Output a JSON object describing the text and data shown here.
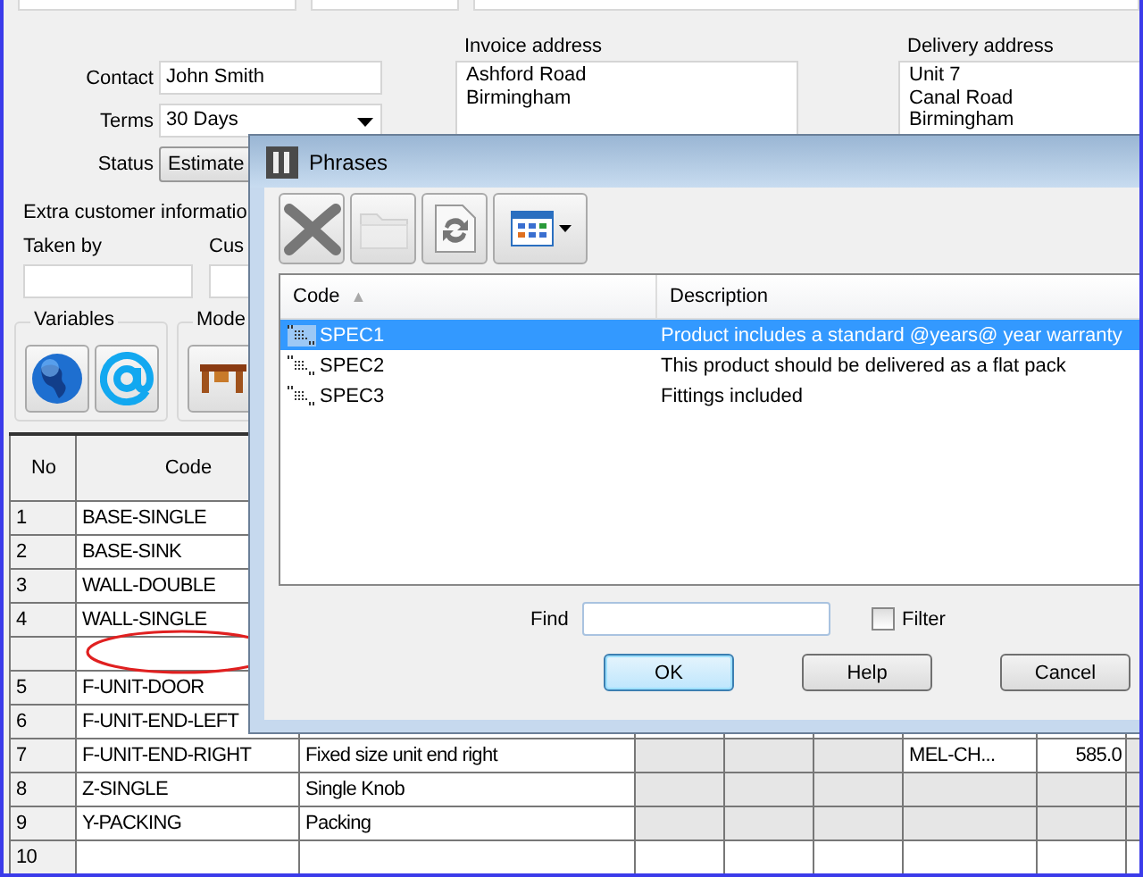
{
  "customer": {
    "fields": [
      {
        "kind": "text",
        "label": "Contact",
        "value": "John Smith"
      },
      {
        "kind": "dropdown",
        "label": "Terms",
        "value": "30 Days"
      },
      {
        "kind": "button",
        "label": "Status",
        "value": "Estimate"
      }
    ]
  },
  "invoice_address": {
    "label": "Invoice address",
    "lines": [
      "Ashford Road",
      "Birmingham"
    ]
  },
  "delivery_address": {
    "label": "Delivery address",
    "lines": [
      "Unit 7",
      "Canal Road",
      "Birmingham"
    ]
  },
  "extra_info": {
    "heading": "Extra customer informatio",
    "fields": [
      {
        "label": "Taken by"
      },
      {
        "label": "Cus"
      }
    ]
  },
  "groups": [
    {
      "label": "Variables",
      "buttons": [
        {
          "kind": "globe"
        },
        {
          "kind": "at"
        }
      ]
    },
    {
      "label": "Mode",
      "buttons": [
        {
          "kind": "desk"
        }
      ]
    }
  ],
  "grid": {
    "columns": [
      {
        "label": "No"
      },
      {
        "label": "Code"
      }
    ],
    "rows": [
      {
        "kind": "item",
        "no": "1",
        "code": "BASE-SINGLE"
      },
      {
        "kind": "item",
        "no": "2",
        "code": "BASE-SINK"
      },
      {
        "kind": "item",
        "no": "3",
        "code": "WALL-DOUBLE"
      },
      {
        "kind": "item",
        "no": "4",
        "code": "WALL-SINGLE"
      },
      {
        "kind": "blank"
      },
      {
        "kind": "item",
        "no": "5",
        "code": "F-UNIT-DOOR"
      },
      {
        "kind": "item",
        "no": "6",
        "code": "F-UNIT-END-LEFT"
      },
      {
        "kind": "item",
        "no": "7",
        "code": "F-UNIT-END-RIGHT",
        "description": "Fixed size unit end right",
        "column_7": "MEL-CH...",
        "column_8": "585.0",
        "shaded": true
      },
      {
        "kind": "item",
        "no": "8",
        "code": "Z-SINGLE",
        "description": "Single Knob",
        "shaded": true
      },
      {
        "kind": "item",
        "no": "9",
        "code": "Y-PACKING",
        "description": "Packing",
        "shaded": true
      },
      {
        "kind": "item",
        "no": "10",
        "shaded": false
      }
    ]
  },
  "annotation": {
    "kind": "ellipse"
  },
  "dialog": {
    "title": "Phrases",
    "tools": [
      {
        "kind": "delete",
        "disabled": false
      },
      {
        "kind": "folder",
        "disabled": true
      },
      {
        "kind": "refresh",
        "disabled": false
      },
      {
        "kind": "view",
        "disabled": false
      }
    ],
    "list": {
      "columns": [
        {
          "label": "Code",
          "sort_indicator": "▲"
        },
        {
          "label": "Description"
        }
      ],
      "rows": [
        {
          "code": "SPEC1",
          "description": "Product includes a standard @years@ year warranty",
          "selected": true
        },
        {
          "code": "SPEC2",
          "description": "This product should be delivered as a flat pack",
          "selected": false
        },
        {
          "code": "SPEC3",
          "description": "Fittings included",
          "selected": false
        }
      ]
    },
    "find": {
      "label": "Find"
    },
    "filter": {
      "label": "Filter",
      "checked": false
    },
    "buttons": [
      {
        "label": "OK",
        "default": true
      },
      {
        "label": "Help",
        "default": false
      },
      {
        "label": "Cancel",
        "default": false
      }
    ]
  }
}
